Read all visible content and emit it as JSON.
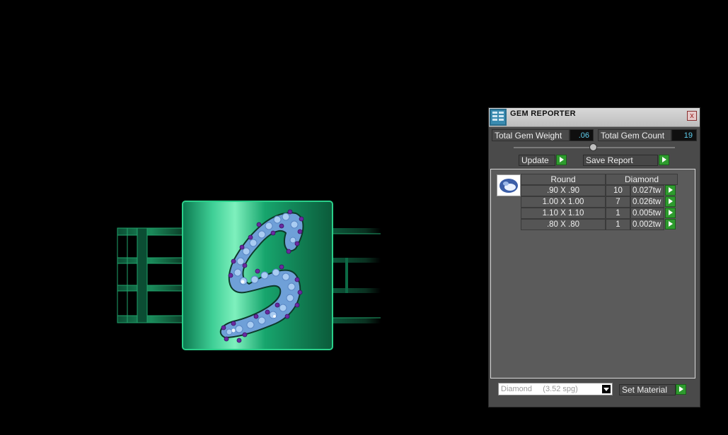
{
  "panel": {
    "title": "GEM REPORTER",
    "close_label": "x",
    "total_weight_label": "Total Gem Weight",
    "total_weight_value": ".06",
    "total_count_label": "Total Gem Count",
    "total_count_value": "19",
    "update_label": "Update",
    "save_label": "Save Report",
    "header_shape": "Round",
    "header_material": "Diamond",
    "rows": [
      {
        "size": ".90 X .90",
        "count": "10",
        "weight": "0.027tw"
      },
      {
        "size": "1.00 X 1.00",
        "count": "7",
        "weight": "0.026tw"
      },
      {
        "size": "1.10 X 1.10",
        "count": "1",
        "weight": "0.005tw"
      },
      {
        "size": ".80 X .80",
        "count": "1",
        "weight": "0.002tw"
      }
    ],
    "material_select": "Diamond     (3.52 spg)",
    "set_material_label": "Set Material"
  },
  "colors": {
    "ring_green": "#0c9a68",
    "stone_blue": "#8fb8ec",
    "stone_purple": "#6a2aa0",
    "button_green": "#2e9b2e"
  },
  "icons": [
    "gem-reporter-icon",
    "close-icon",
    "play-arrow-icon",
    "dropdown-arrow-icon",
    "gem-shape-icon"
  ]
}
